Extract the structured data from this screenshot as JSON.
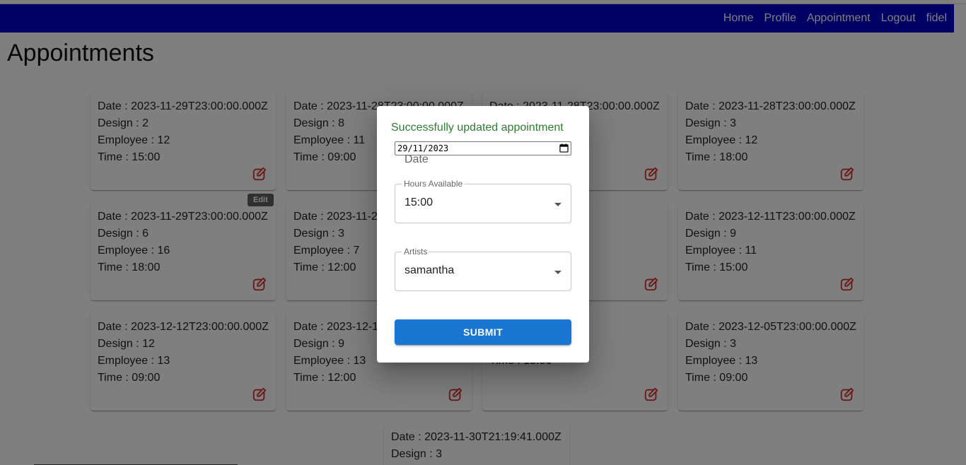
{
  "nav": {
    "items": [
      "Home",
      "Profile",
      "Appointment",
      "Logout",
      "fidel"
    ]
  },
  "page": {
    "title": "Appointments"
  },
  "appointments": [
    {
      "date": "Date : 2023-11-29T23:00:00.000Z",
      "design": "Design : 2",
      "employee": "Employee : 12",
      "time": "Time : 15:00"
    },
    {
      "date": "Date : 2023-11-28T23:00:00.000Z",
      "design": "Design : 8",
      "employee": "Employee : 11",
      "time": "Time : 09:00"
    },
    {
      "date": "Date : 2023-11-28T23:00:00.000Z",
      "design": "",
      "employee": "",
      "time": ""
    },
    {
      "date": "Date : 2023-11-28T23:00:00.000Z",
      "design": "Design : 3",
      "employee": "Employee : 12",
      "time": "Time : 18:00"
    },
    {
      "date": "Date : 2023-11-29T23:00:00.000Z",
      "design": "Design : 6",
      "employee": "Employee : 16",
      "time": "Time : 18:00"
    },
    {
      "date": "Date : 2023-11-2",
      "design": "Design : 3",
      "employee": "Employee : 7",
      "time": "Time : 12:00"
    },
    {
      "date": "Date :           3:00:00.000Z",
      "design": "",
      "employee": "",
      "time": ""
    },
    {
      "date": "Date : 2023-12-11T23:00:00.000Z",
      "design": "Design : 9",
      "employee": "Employee : 11",
      "time": "Time : 15:00"
    },
    {
      "date": "Date : 2023-12-12T23:00:00.000Z",
      "design": "Design : 12",
      "employee": "Employee : 13",
      "time": "Time : 09:00"
    },
    {
      "date": "Date : 2023-12-1",
      "design": "Design : 9",
      "employee": "Employee : 13",
      "time": "Time : 12:00"
    },
    {
      "date": "Date :           3:00:00.000Z",
      "design": "",
      "employee": "Employee : 12",
      "time": "Time : 15:00"
    },
    {
      "date": "Date : 2023-12-05T23:00:00.000Z",
      "design": "Design : 3",
      "employee": "Employee : 13",
      "time": "Time : 09:00"
    },
    {
      "date": "Date : 2023-11-30T21:19:41.000Z",
      "design": "Design : 3",
      "employee": "",
      "time": ""
    }
  ],
  "tooltip": {
    "text": "Edit"
  },
  "icons": {
    "edit": "edit-square-icon",
    "calendar": "calendar-icon",
    "dropdown": "arrow-drop-down-icon"
  },
  "colors": {
    "navbar": "#0000c8",
    "edit_icon": "#d32f2f",
    "success": "#2e7d32",
    "submit": "#1976d2"
  },
  "modal": {
    "success_message": "Successfully updated appointment",
    "date_value": "29/11/2023",
    "date_label": "Date",
    "hours": {
      "label": "Hours Available",
      "value": "15:00"
    },
    "artists": {
      "label": "Artists",
      "value": "samantha"
    },
    "submit_label": "SUBMIT"
  }
}
